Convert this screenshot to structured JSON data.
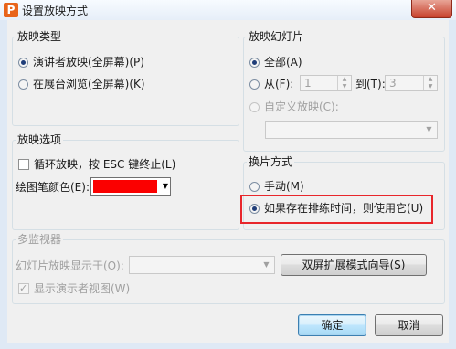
{
  "window": {
    "title": "设置放映方式",
    "app_icon_letter": "P",
    "close_label": "✕"
  },
  "show_type": {
    "legend": "放映类型",
    "options": [
      {
        "label": "演讲者放映(全屏幕)(P)",
        "selected": true
      },
      {
        "label": "在展台浏览(全屏幕)(K)",
        "selected": false
      }
    ]
  },
  "slides": {
    "legend": "放映幻灯片",
    "all_label": "全部(A)",
    "from_label": "从(F):",
    "from_value": "1",
    "to_label": "到(T):",
    "to_value": "3",
    "custom_label": "自定义放映(C):",
    "custom_value": ""
  },
  "show_options": {
    "legend": "放映选项",
    "loop_label": "循环放映，按 ESC 键终止(L)",
    "loop_checked": false,
    "pen_color_label": "绘图笔颜色(E):",
    "pen_color": "#fb0000"
  },
  "advance": {
    "legend": "换片方式",
    "manual_label": "手动(M)",
    "timings_label": "如果存在排练时间，则使用它(U)",
    "selected": "timings"
  },
  "multi_monitor": {
    "legend": "多监视器",
    "display_on_label": "幻灯片放映显示于(O):",
    "display_on_value": "",
    "wizard_button": "双屏扩展模式向导(S)",
    "presenter_view_label": "显示演示者视图(W)",
    "presenter_view_checked": true
  },
  "buttons": {
    "ok": "确定",
    "cancel": "取消"
  },
  "colors": {
    "highlight": "#e8262b",
    "accent": "#3c7fb1"
  }
}
